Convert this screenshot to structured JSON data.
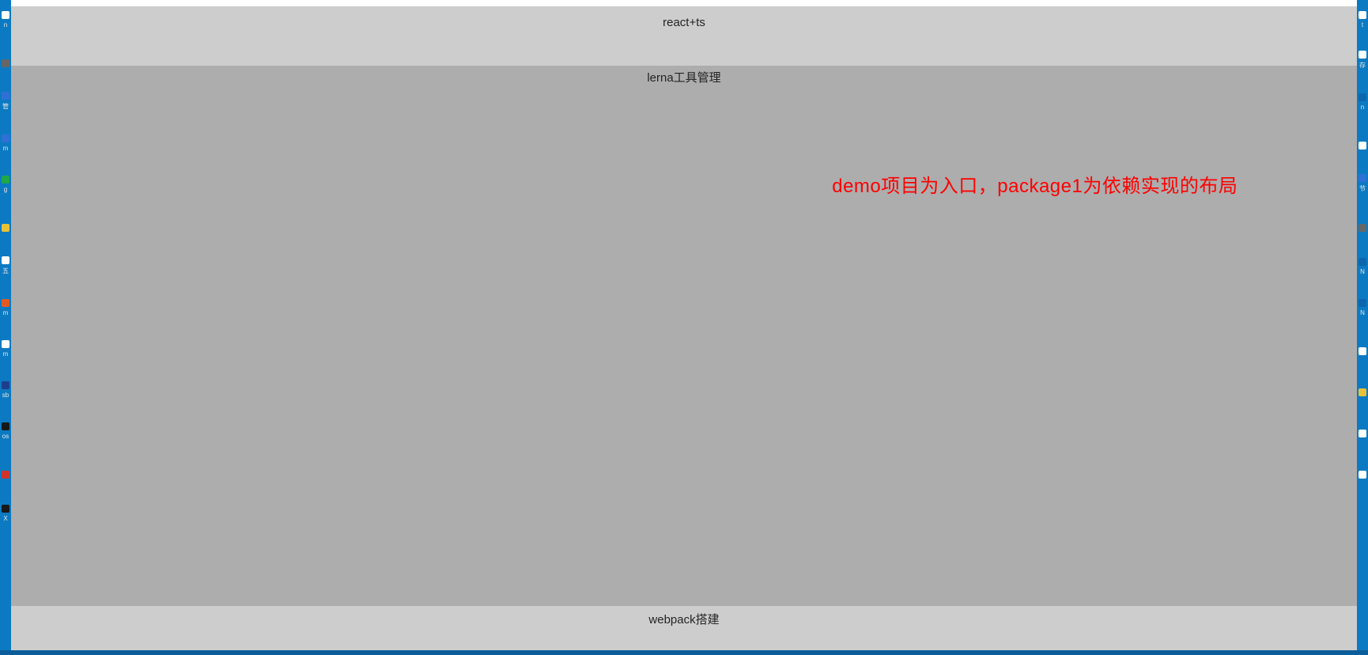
{
  "browser": {
    "header_label": "react+ts",
    "middle_label": "lerna工具管理",
    "footer_label": "webpack搭建",
    "annotation": "demo项目为入口，package1为依赖实现的布局"
  },
  "desktop": {
    "left_icons": [
      {
        "name": "folder-icon",
        "color": "c-white",
        "label": "n"
      },
      {
        "name": "app-icon",
        "color": "c-gray",
        "label": ""
      },
      {
        "name": "store-icon",
        "color": "c-blue",
        "label": "管"
      },
      {
        "name": "shortcut-icon",
        "color": "c-blue",
        "label": "m"
      },
      {
        "name": "chrome-icon",
        "color": "c-green",
        "label": "g"
      },
      {
        "name": "pycharm-icon",
        "color": "c-yellow",
        "label": ""
      },
      {
        "name": "wubi-icon",
        "color": "c-white",
        "label": "五"
      },
      {
        "name": "music-icon",
        "color": "c-orange",
        "label": "m"
      },
      {
        "name": "file-icon",
        "color": "c-white",
        "label": "m"
      },
      {
        "name": "sublime-icon",
        "color": "c-navy",
        "label": "sb"
      },
      {
        "name": "app2-icon",
        "color": "c-black",
        "label": "os"
      },
      {
        "name": "ubuntu-icon",
        "color": "c-red",
        "label": ""
      },
      {
        "name": "x-icon",
        "color": "c-black",
        "label": "X"
      }
    ],
    "right_icons": [
      {
        "name": "folder2-icon",
        "color": "c-white",
        "label": "t"
      },
      {
        "name": "doc-icon",
        "color": "c-white",
        "label": "存"
      },
      {
        "name": "gear-icon",
        "color": "c-skybl",
        "label": "n"
      },
      {
        "name": "blank-icon",
        "color": "c-white",
        "label": ""
      },
      {
        "name": "shortcut2-icon",
        "color": "c-blue",
        "label": "节"
      },
      {
        "name": "app3-icon",
        "color": "c-gray",
        "label": ""
      },
      {
        "name": "link-icon",
        "color": "c-skybl",
        "label": "N"
      },
      {
        "name": "link2-icon",
        "color": "c-skybl",
        "label": "N"
      },
      {
        "name": "folder3-icon",
        "color": "c-white",
        "label": ""
      },
      {
        "name": "pkg-icon",
        "color": "c-yellow",
        "label": ""
      },
      {
        "name": "bin-icon",
        "color": "c-white",
        "label": ""
      },
      {
        "name": "bin2-icon",
        "color": "c-white",
        "label": ""
      }
    ]
  }
}
